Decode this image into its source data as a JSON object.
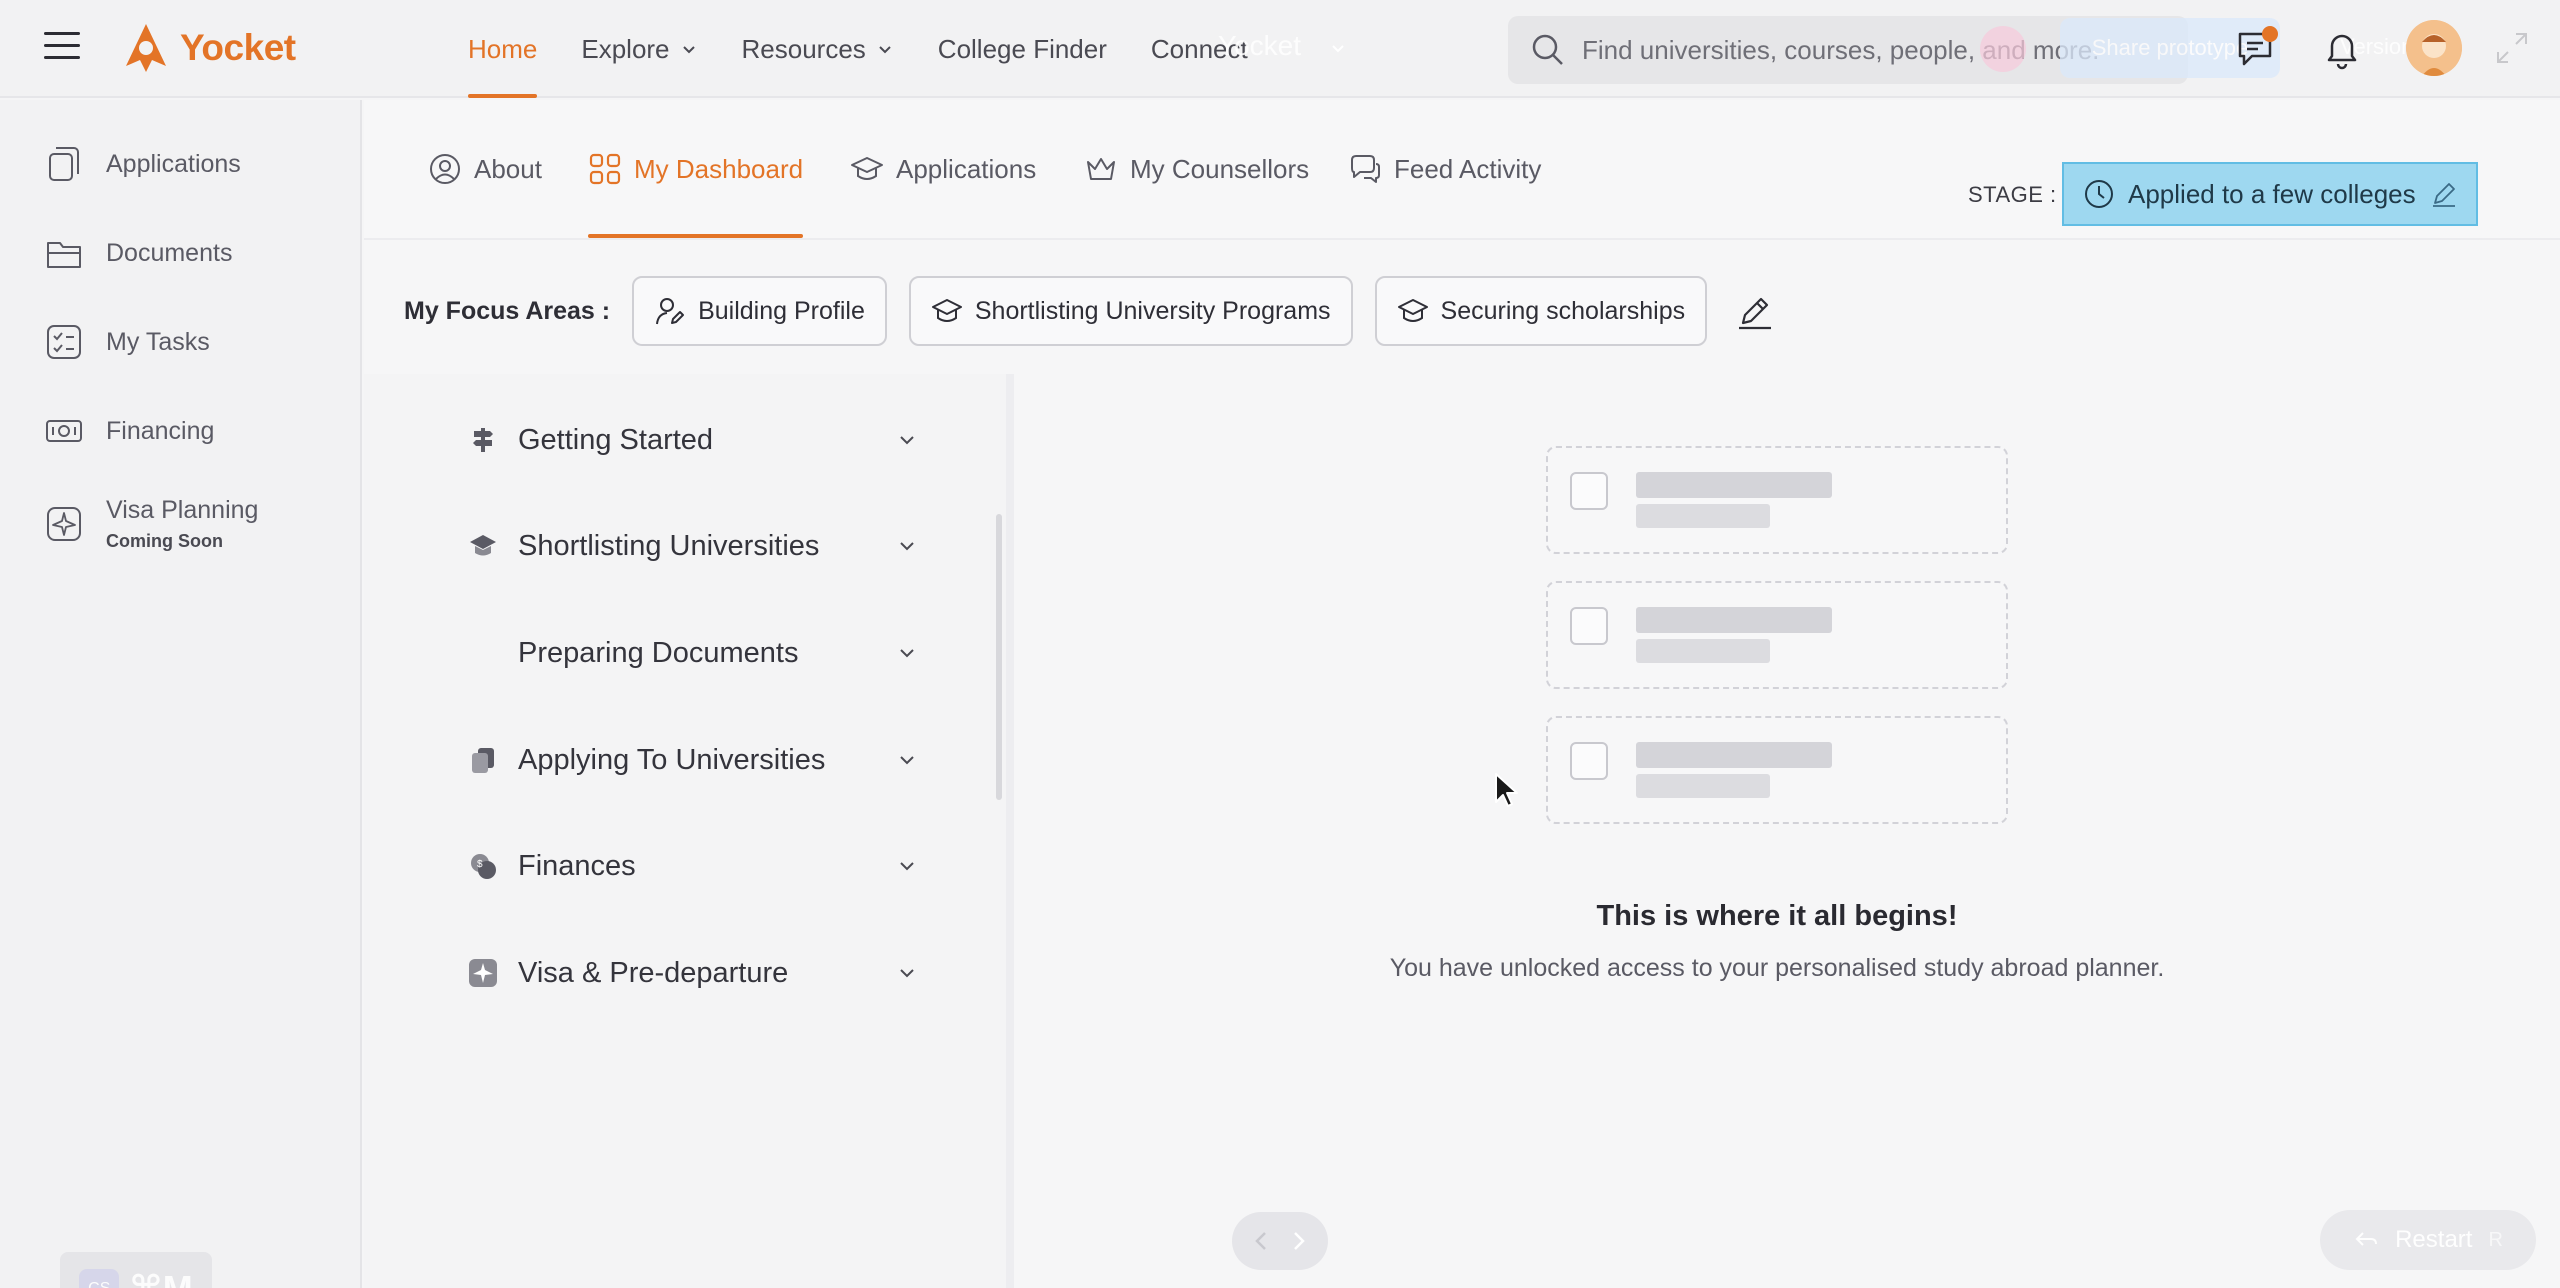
{
  "brand": {
    "name": "Yocket",
    "color": "#e37427"
  },
  "topnav": {
    "items": [
      {
        "label": "Home",
        "active": true,
        "dropdown": false
      },
      {
        "label": "Explore",
        "active": false,
        "dropdown": true
      },
      {
        "label": "Resources",
        "active": false,
        "dropdown": true
      },
      {
        "label": "College Finder",
        "active": false,
        "dropdown": false
      },
      {
        "label": "Connect",
        "active": false,
        "dropdown": false
      }
    ],
    "ghost_title": "Yocket",
    "search_placeholder": "Find universities, courses, people, and more.",
    "ghost_share": "Share prototype",
    "ghost_versions": "Versions"
  },
  "sidebar": {
    "items": [
      {
        "label": "Applications",
        "icon": "applications-icon"
      },
      {
        "label": "Documents",
        "icon": "documents-icon"
      },
      {
        "label": "My Tasks",
        "icon": "tasks-icon"
      },
      {
        "label": "Financing",
        "icon": "financing-icon"
      },
      {
        "label": "Visa Planning",
        "sub": "Coming Soon",
        "icon": "visa-icon"
      }
    ],
    "shortcut": {
      "badge": "CS",
      "keys": "⌘M"
    }
  },
  "tabs": [
    {
      "label": "About",
      "active": false
    },
    {
      "label": "My Dashboard",
      "active": true
    },
    {
      "label": "Applications",
      "active": false
    },
    {
      "label": "My Counsellors",
      "active": false
    },
    {
      "label": "Feed Activity",
      "active": false
    }
  ],
  "stage": {
    "label": "STAGE :",
    "value": "Applied to a few colleges"
  },
  "focus": {
    "label": "My Focus Areas :",
    "chips": [
      "Building Profile",
      "Shortlisting University Programs",
      "Securing scholarships"
    ]
  },
  "accordion": [
    {
      "label": "Getting Started"
    },
    {
      "label": "Shortlisting Universities"
    },
    {
      "label": "Preparing Documents"
    },
    {
      "label": "Applying To Universities"
    },
    {
      "label": "Finances"
    },
    {
      "label": "Visa & Pre-departure"
    }
  ],
  "empty_state": {
    "title": "This is where it all begins!",
    "subtitle": "You have unlocked access to your personalised study abroad planner."
  },
  "footer": {
    "restart_label": "Restart",
    "restart_key": "R"
  },
  "colors": {
    "accent": "#e37427",
    "stage_bg": "#9ed8f0",
    "stage_border": "#62bde4"
  }
}
